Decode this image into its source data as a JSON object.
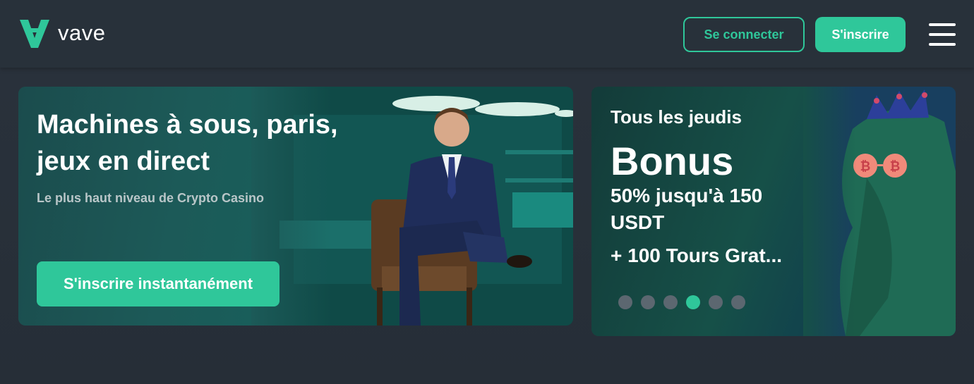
{
  "header": {
    "brand_name": "vave",
    "login_label": "Se connecter",
    "signup_label": "S'inscrire",
    "menu_icon": "hamburger-menu-icon",
    "accent_color": "#2fc79a"
  },
  "hero": {
    "title": "Machines à sous, paris, jeux en direct",
    "subtitle": "Le plus haut niveau de Crypto Casino",
    "cta_label": "S'inscrire instantanément"
  },
  "promo": {
    "kicker": "Tous les jeudis",
    "title": "Bonus",
    "detail": "50% jusqu'à 150 USDT",
    "extra": "+ 100 Tours Grat...",
    "carousel": {
      "total": 6,
      "active_index": 4
    }
  }
}
